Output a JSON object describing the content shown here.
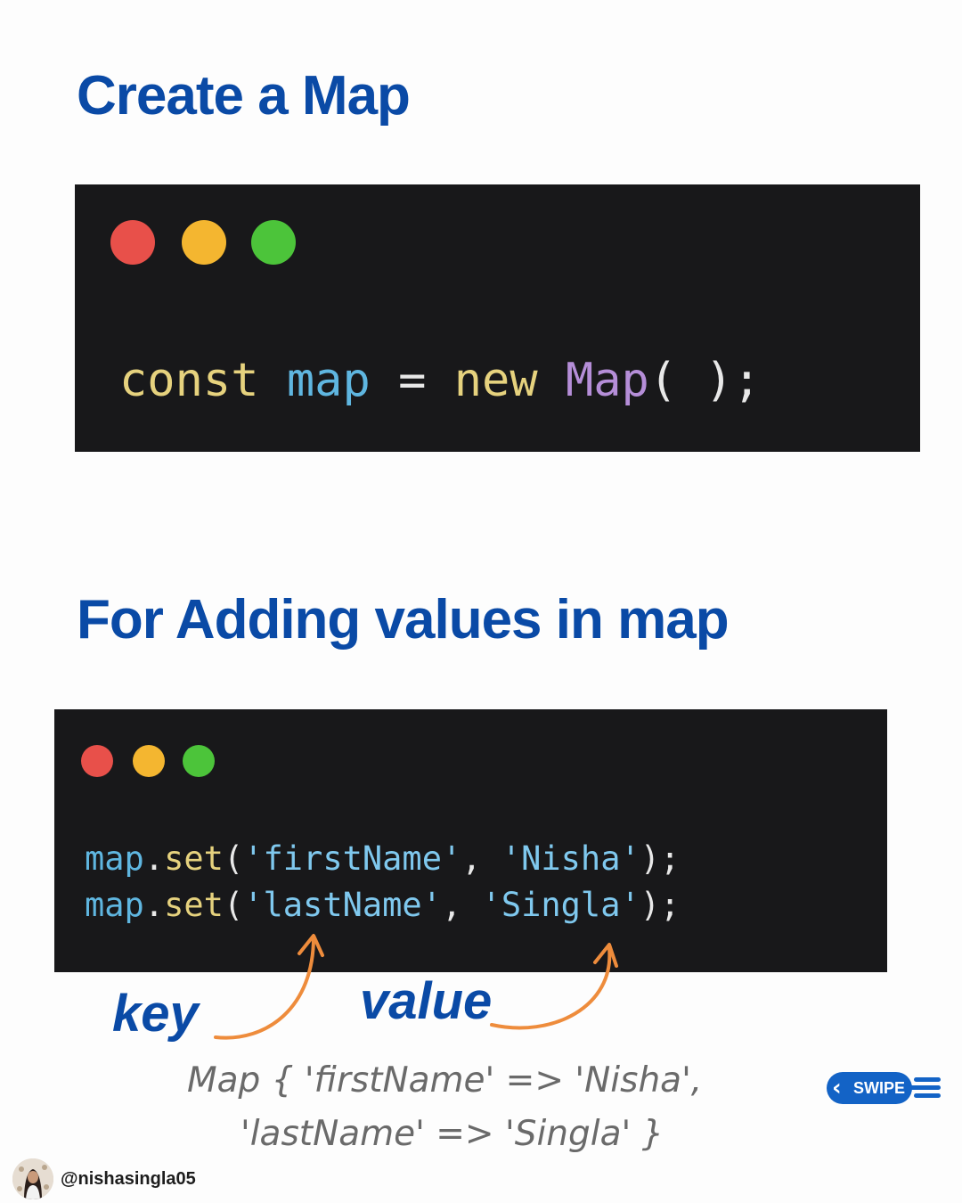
{
  "headings": {
    "create": "Create a Map",
    "adding": "For Adding values in map"
  },
  "colors": {
    "heading": "#0a4aa6",
    "code_bg": "#18181a",
    "dot_red": "#e8504a",
    "dot_yellow": "#f4b630",
    "dot_green": "#4cc43a",
    "keyword": "#e6d27e",
    "identifier": "#5fb6e0",
    "operator": "#e8e8e8",
    "class_name": "#b58ed8",
    "punctuation": "#e8e8e8",
    "string": "#7fc8ee",
    "arrow": "#ee8c3c",
    "output_text": "#6a6a6a",
    "swipe": "#1363c6"
  },
  "code1": {
    "tokens": [
      {
        "text": "const",
        "color": "#e6d27e"
      },
      {
        "text": " ",
        "color": "#e8e8e8"
      },
      {
        "text": "map",
        "color": "#5fb6e0"
      },
      {
        "text": " = ",
        "color": "#e8e8e8"
      },
      {
        "text": "new",
        "color": "#e6d27e"
      },
      {
        "text": " ",
        "color": "#e8e8e8"
      },
      {
        "text": "Map",
        "color": "#b58ed8"
      },
      {
        "text": "( );",
        "color": "#e8e8e8"
      }
    ]
  },
  "code2": {
    "lines": [
      [
        {
          "text": "map",
          "color": "#5fb6e0"
        },
        {
          "text": ".",
          "color": "#e8e8e8"
        },
        {
          "text": "set",
          "color": "#e6d27e"
        },
        {
          "text": "(",
          "color": "#e8e8e8"
        },
        {
          "text": "'firstName'",
          "color": "#7fc8ee"
        },
        {
          "text": ", ",
          "color": "#e8e8e8"
        },
        {
          "text": "'Nisha'",
          "color": "#7fc8ee"
        },
        {
          "text": ");",
          "color": "#e8e8e8"
        }
      ],
      [
        {
          "text": "map",
          "color": "#5fb6e0"
        },
        {
          "text": ".",
          "color": "#e8e8e8"
        },
        {
          "text": "set",
          "color": "#e6d27e"
        },
        {
          "text": "(",
          "color": "#e8e8e8"
        },
        {
          "text": "'lastName'",
          "color": "#7fc8ee"
        },
        {
          "text": ", ",
          "color": "#e8e8e8"
        },
        {
          "text": "'Singla'",
          "color": "#7fc8ee"
        },
        {
          "text": ");",
          "color": "#e8e8e8"
        }
      ]
    ]
  },
  "annotations": {
    "key_label": "key",
    "value_label": "value"
  },
  "output": {
    "line1": "Map { 'firstName' => 'Nisha',",
    "line2": "'lastName' => 'Singla' }"
  },
  "swipe": {
    "label": "SWIPE",
    "icon": "chevron-left-icon"
  },
  "author": {
    "handle": "@nishasingla05",
    "avatar_icon": "profile-photo"
  }
}
